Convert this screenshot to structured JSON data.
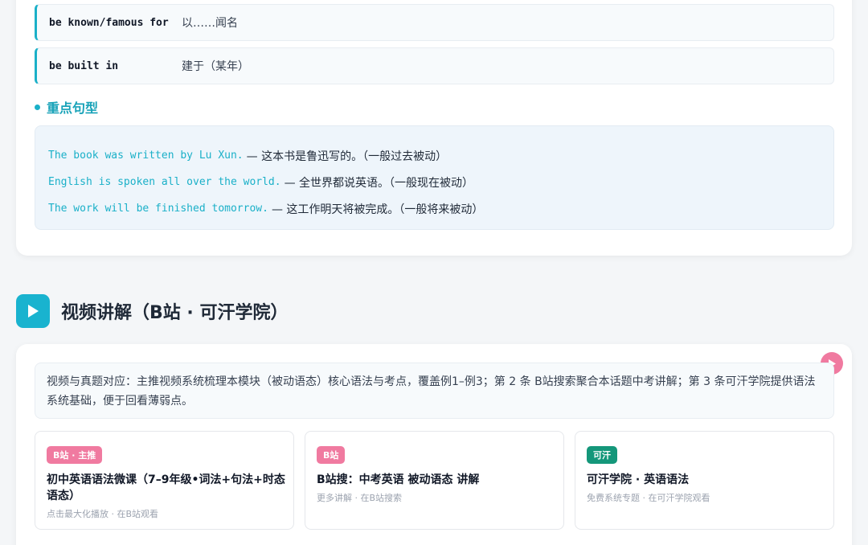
{
  "phrases": [
    {
      "en": "be known/famous for",
      "zh": "以……闻名"
    },
    {
      "en": "be built in",
      "zh": "建于（某年）"
    }
  ],
  "key_sentences": {
    "title": "重点句型",
    "items": [
      {
        "en": "The book was written by Lu Xun.",
        "zh": "— 这本书是鲁迅写的。（一般过去被动）"
      },
      {
        "en": "English is spoken all over the world.",
        "zh": "— 全世界都说英语。（一般现在被动）"
      },
      {
        "en": "The work will be finished tomorrow.",
        "zh": "— 这工作明天将被完成。（一般将来被动）"
      }
    ]
  },
  "video_section": {
    "title": "视频讲解（B站 · 可汗学院）",
    "intro": "视频与真题对应：主推视频系统梳理本模块（被动语态）核心语法与考点，覆盖例1–例3；第 2 条 B站搜索聚合本话题中考讲解；第 3 条可汗学院提供语法系统基础，便于回看薄弱点。",
    "cards": [
      {
        "badge": "B站 · 主推",
        "badge_color": "#f07aa0",
        "title": "初中英语语法微课（7–9年级•词法+句法+时态语态）",
        "subtitle": "点击最大化播放 · 在B站观看"
      },
      {
        "badge": "B站",
        "badge_color": "#f07aa0",
        "title": "B站搜：中考英语 被动语态 讲解",
        "subtitle": "更多讲解 · 在B站搜索"
      },
      {
        "badge": "可汗",
        "badge_color": "#14977a",
        "title": "可汗学院 · 英语语法",
        "subtitle": "免费系统专题 · 在可汗学院观看"
      }
    ]
  },
  "colors": {
    "accent": "#1ab0c8",
    "bilibili_pink": "#f07aa0",
    "khan_green": "#14977a"
  }
}
